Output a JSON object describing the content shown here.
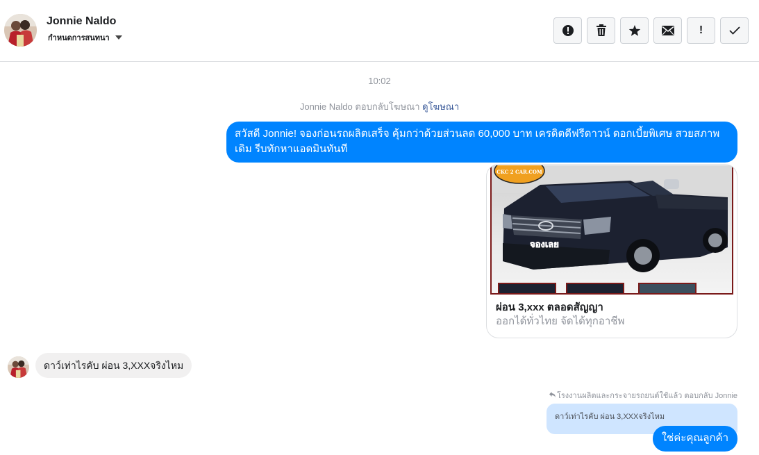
{
  "header": {
    "name": "Jonnie Naldo",
    "assign_label": "กำหนดการสนทนา",
    "actions": [
      {
        "icon": "alert-circle-icon",
        "text": ""
      },
      {
        "icon": "trash-icon",
        "text": ""
      },
      {
        "icon": "star-icon",
        "text": ""
      },
      {
        "icon": "envelope-icon",
        "text": ""
      },
      {
        "icon": "exclamation-icon",
        "text": "!"
      },
      {
        "icon": "check-icon",
        "text": ""
      }
    ]
  },
  "thread": {
    "time": "10:02",
    "ad_reply_prefix": "Jonnie Naldo ตอบกลับโฆษณา",
    "ad_reply_link": "ดูโฆษณา",
    "outgoing_message": "สวัสดี Jonnie! จองก่อนรถผลิตเสร็จ คุ้มกว่าด้วยส่วนลด 60,000 บาท เครดิตดีฟรีดาวน์ ดอกเบี้ยพิเศษ สวยสภาพเดิม รีบทักหาแอดมินทันที",
    "card": {
      "title": "ผ่อน 3,xxx ตลอดสัญญา",
      "subtitle": "ออกได้ทั่วไทย จัดได้ทุกอาชีพ",
      "logo_text": "CKC 2 CAR.COM",
      "sticker_text": "จองเลย"
    },
    "incoming_message": "ดาว์เท่าไรคับ ผ่อน 3,XXXจริงไหม",
    "reply_meta": "โรงงานผลิตและกระจายรถยนต์ใช้แล้ว ตอบกลับ Jonnie",
    "quoted_message": "ดาว์เท่าไรคับ ผ่อน 3,XXXจริงไหม",
    "reply_message": "ใช่ค่ะคุณลูกค้า"
  },
  "colors": {
    "accent": "#0084ff",
    "incoming_bubble": "#f1f0f0",
    "quote_bubble": "#cfe5ff"
  }
}
